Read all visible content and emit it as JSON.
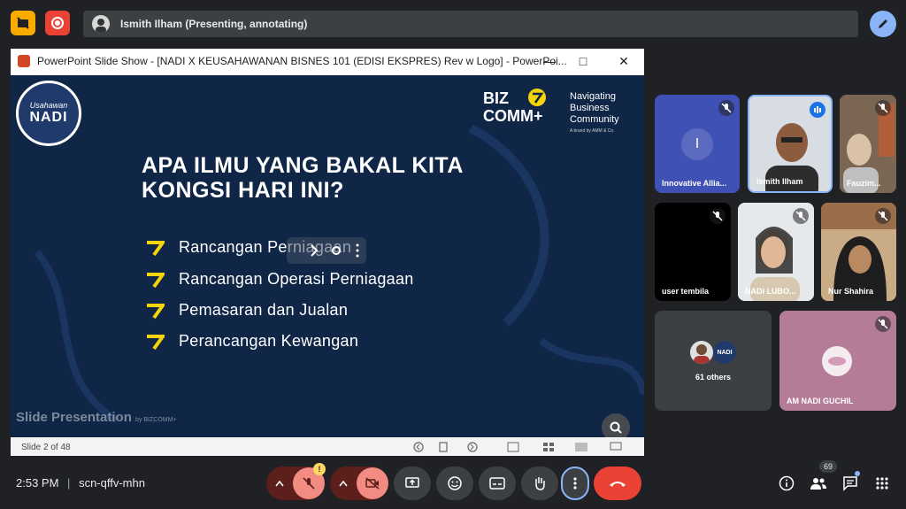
{
  "top_bar": {
    "presenter_status": "Ismith Ilham (Presenting, annotating)"
  },
  "ppt_window": {
    "title": "PowerPoint Slide Show - [NADI X KEUSAHAWANAN  BISNES 101 (EDISI EKSPRES) Rev w Logo] - PowerPoi...",
    "status_slide": "Slide 2 of 48"
  },
  "slide": {
    "logo_small": "Usahawan",
    "logo_big": "NADI",
    "bizcomm_line1": "BIZ",
    "bizcomm_line2": "COMM+",
    "bizcomm_tag_1": "Navigating",
    "bizcomm_tag_2": "Business",
    "bizcomm_tag_3": "Community",
    "bizcomm_tag_small": "A brand by AMM & Co.",
    "heading_line1": "APA ILMU YANG BAKAL KITA",
    "heading_line2": "KONGSI HARI INI?",
    "bullets": [
      "Rancangan Perniagaan",
      "Rancangan Operasi Perniagaan",
      "Pemasaran dan Jualan",
      "Perancangan Kewangan"
    ],
    "footer": "Slide Presentation",
    "footer_by": "by BIZCOMM+"
  },
  "participants": [
    {
      "name": "Innovative Allia...",
      "initial": "I",
      "muted": true,
      "bg": "#3f51b5"
    },
    {
      "name": "Ismith Ilham",
      "speaking": true
    },
    {
      "name": "Fauzim...",
      "muted": true
    },
    {
      "name": "user tembila",
      "muted": true,
      "bg": "#000000"
    },
    {
      "name": "NADI LUBO...",
      "muted": true
    },
    {
      "name": "Nur Shahira",
      "muted": true
    },
    {
      "name": "61 others",
      "badge": "NADI"
    },
    {
      "name": "AM NADI GUCHIL",
      "muted": true,
      "bg": "#b47c98"
    }
  ],
  "bottom_bar": {
    "time": "2:53 PM",
    "meeting_code": "scn-qffv-mhn",
    "people_count": "69",
    "mic_warning": "!"
  },
  "colors": {
    "slide_bg": "#0f2647",
    "accent_yellow": "#f5d50a",
    "end_call_red": "#ea4335",
    "muted_red": "#f28b82"
  }
}
